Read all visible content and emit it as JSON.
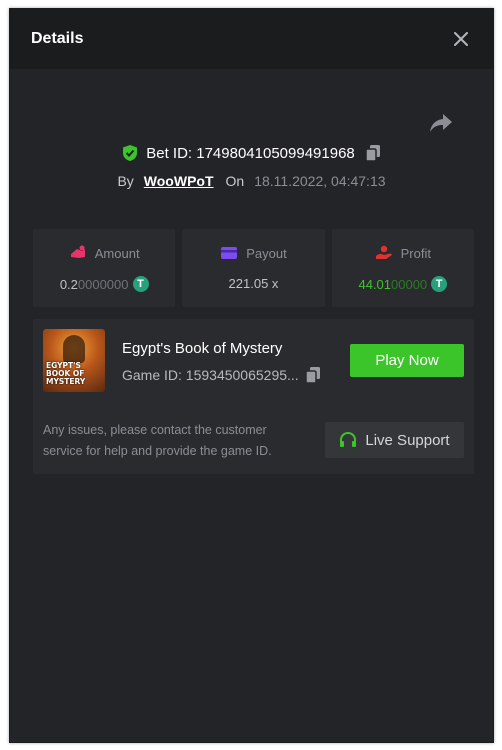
{
  "header": {
    "title": "Details"
  },
  "bet": {
    "id_label": "Bet ID: 1749804105099491968",
    "by_label": "By",
    "user": "WooWPoT",
    "on_label": "On",
    "time": "18.11.2022, 04:47:13"
  },
  "stats": {
    "amount": {
      "label": "Amount",
      "value_main": "0.2",
      "value_tail": "0000000"
    },
    "payout": {
      "label": "Payout",
      "value": "221.05 x"
    },
    "profit": {
      "label": "Profit",
      "value_main": "44.01",
      "value_tail": "00000"
    }
  },
  "game": {
    "name": "Egypt's Book of Mystery",
    "id_label": "Game ID: 1593450065295...",
    "thumb_line1": "EGYPT'S",
    "thumb_line2": "BOOK OF MYSTERY",
    "play_label": "Play Now"
  },
  "support": {
    "help_text": "Any issues, please contact the customer service for help and provide the game ID.",
    "button_label": "Live Support"
  },
  "coin_symbol": "T",
  "colors": {
    "accent_green": "#3cc52a",
    "panel_bg": "#232427",
    "header_bg": "#1b1c1e",
    "amount_icon": "#e8336b",
    "payout_icon": "#7b4cf0",
    "profit_icon": "#e0322f",
    "tether": "#26a17b"
  },
  "icons": [
    "close-icon",
    "share-icon",
    "shield-check-icon",
    "copy-icon",
    "amount-icon",
    "payout-icon",
    "profit-icon",
    "tether-icon",
    "headset-icon"
  ]
}
